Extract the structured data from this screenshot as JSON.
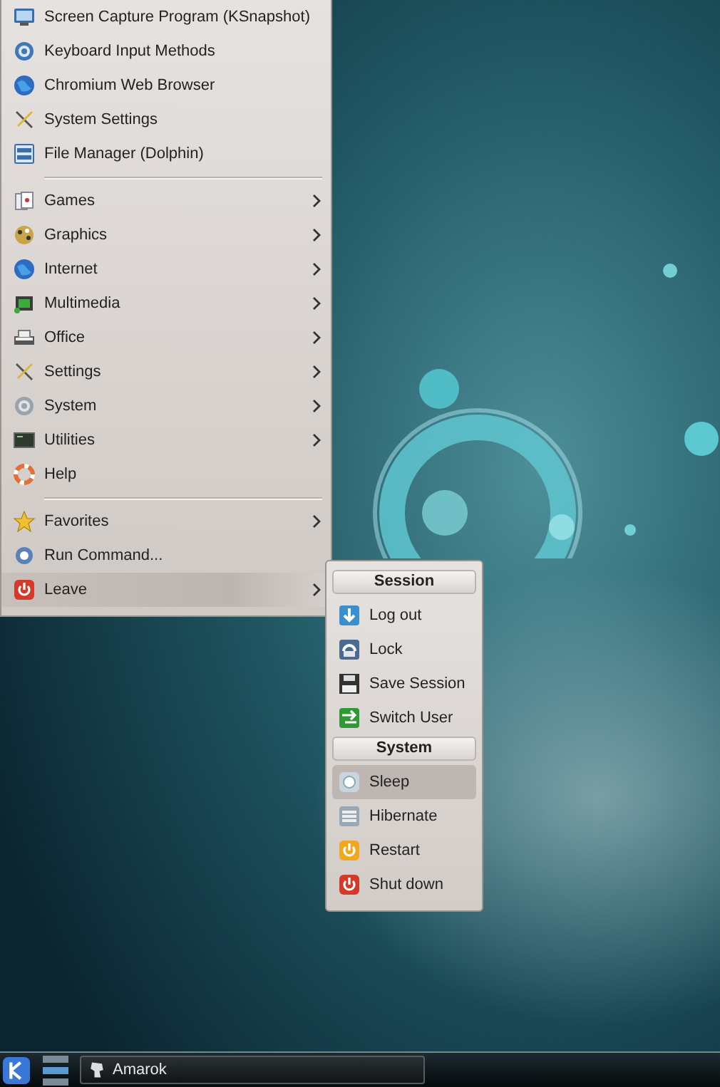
{
  "menu": {
    "items": [
      {
        "kind": "item",
        "label": "Screen Capture Program (KSnapshot)",
        "has_submenu": false,
        "selected": false
      },
      {
        "kind": "item",
        "label": "Keyboard Input Methods",
        "has_submenu": false,
        "selected": false
      },
      {
        "kind": "item",
        "label": "Chromium Web Browser",
        "has_submenu": false,
        "selected": false
      },
      {
        "kind": "item",
        "label": "System Settings",
        "has_submenu": false,
        "selected": false
      },
      {
        "kind": "item",
        "label": "File Manager (Dolphin)",
        "has_submenu": false,
        "selected": false
      },
      {
        "kind": "separator"
      },
      {
        "kind": "item",
        "label": "Games",
        "has_submenu": true,
        "selected": false
      },
      {
        "kind": "item",
        "label": "Graphics",
        "has_submenu": true,
        "selected": false
      },
      {
        "kind": "item",
        "label": "Internet",
        "has_submenu": true,
        "selected": false
      },
      {
        "kind": "item",
        "label": "Multimedia",
        "has_submenu": true,
        "selected": false
      },
      {
        "kind": "item",
        "label": "Office",
        "has_submenu": true,
        "selected": false
      },
      {
        "kind": "item",
        "label": "Settings",
        "has_submenu": true,
        "selected": false
      },
      {
        "kind": "item",
        "label": "System",
        "has_submenu": true,
        "selected": false
      },
      {
        "kind": "item",
        "label": "Utilities",
        "has_submenu": true,
        "selected": false
      },
      {
        "kind": "item",
        "label": "Help",
        "has_submenu": false,
        "selected": false
      },
      {
        "kind": "separator"
      },
      {
        "kind": "item",
        "label": "Favorites",
        "has_submenu": true,
        "selected": false
      },
      {
        "kind": "item",
        "label": "Run Command...",
        "has_submenu": false,
        "selected": false
      },
      {
        "kind": "item",
        "label": "Leave",
        "has_submenu": true,
        "selected": true
      }
    ]
  },
  "leave_submenu": {
    "sections": [
      {
        "title": "Session",
        "items": [
          {
            "label": "Log out",
            "selected": false
          },
          {
            "label": "Lock",
            "selected": false
          },
          {
            "label": "Save Session",
            "selected": false
          },
          {
            "label": "Switch User",
            "selected": false
          }
        ]
      },
      {
        "title": "System",
        "items": [
          {
            "label": "Sleep",
            "selected": true
          },
          {
            "label": "Hibernate",
            "selected": false
          },
          {
            "label": "Restart",
            "selected": false
          },
          {
            "label": "Shut down",
            "selected": false
          }
        ]
      }
    ]
  },
  "taskbar": {
    "tasks": [
      {
        "label": "Amarok"
      }
    ]
  }
}
